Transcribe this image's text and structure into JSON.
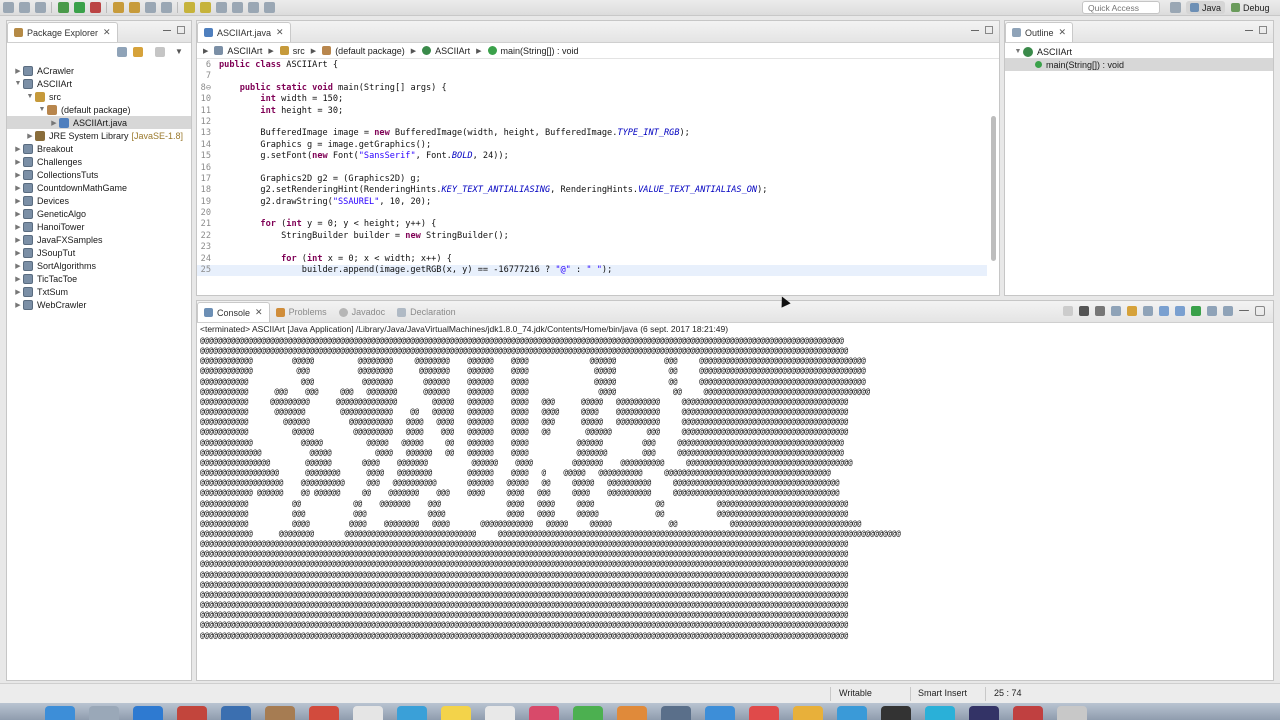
{
  "toolbar": {
    "quick_access_placeholder": "Quick Access",
    "perspectives": [
      "Java",
      "Debug"
    ]
  },
  "package_explorer": {
    "tab_label": "Package Explorer",
    "items": [
      {
        "label": "ACrawler",
        "depth": 0,
        "expanded": false,
        "icon": "project-icon"
      },
      {
        "label": "ASCIIArt",
        "depth": 0,
        "expanded": true,
        "icon": "project-icon"
      },
      {
        "label": "src",
        "depth": 1,
        "expanded": true,
        "icon": "source-folder-icon"
      },
      {
        "label": "(default package)",
        "depth": 2,
        "expanded": true,
        "icon": "package-icon"
      },
      {
        "label": "ASCIIArt.java",
        "depth": 3,
        "expanded": false,
        "icon": "java-file-icon",
        "selected": true
      },
      {
        "label": "JRE System Library",
        "sub": "[JavaSE-1.8]",
        "depth": 1,
        "expanded": false,
        "icon": "library-icon"
      },
      {
        "label": "Breakout",
        "depth": 0,
        "expanded": false,
        "icon": "project-icon"
      },
      {
        "label": "Challenges",
        "depth": 0,
        "expanded": false,
        "icon": "project-icon"
      },
      {
        "label": "CollectionsTuts",
        "depth": 0,
        "expanded": false,
        "icon": "project-icon"
      },
      {
        "label": "CountdownMathGame",
        "depth": 0,
        "expanded": false,
        "icon": "project-icon"
      },
      {
        "label": "Devices",
        "depth": 0,
        "expanded": false,
        "icon": "project-icon"
      },
      {
        "label": "GeneticAlgo",
        "depth": 0,
        "expanded": false,
        "icon": "project-icon"
      },
      {
        "label": "HanoiTower",
        "depth": 0,
        "expanded": false,
        "icon": "project-icon"
      },
      {
        "label": "JavaFXSamples",
        "depth": 0,
        "expanded": false,
        "icon": "project-icon"
      },
      {
        "label": "JSoupTut",
        "depth": 0,
        "expanded": false,
        "icon": "project-icon"
      },
      {
        "label": "SortAlgorithms",
        "depth": 0,
        "expanded": false,
        "icon": "project-icon"
      },
      {
        "label": "TicTacToe",
        "depth": 0,
        "expanded": false,
        "icon": "project-icon"
      },
      {
        "label": "TxtSum",
        "depth": 0,
        "expanded": false,
        "icon": "project-icon"
      },
      {
        "label": "WebCrawler",
        "depth": 0,
        "expanded": false,
        "icon": "project-icon"
      }
    ]
  },
  "editor": {
    "tab_label": "ASCIIArt.java",
    "breadcrumb": [
      "ASCIIArt",
      "src",
      "(default package)",
      "ASCIIArt",
      "main(String[]) : void"
    ],
    "lines": [
      {
        "n": "6",
        "text": "public class ASCIIArt {"
      },
      {
        "n": "7",
        "text": ""
      },
      {
        "n": "8⊖",
        "text": "    public static void main(String[] args) {"
      },
      {
        "n": "10",
        "text": "        int width = 150;"
      },
      {
        "n": "11",
        "text": "        int height = 30;"
      },
      {
        "n": "12",
        "text": ""
      },
      {
        "n": "13",
        "text": "        BufferedImage image = new BufferedImage(width, height, BufferedImage.TYPE_INT_RGB);"
      },
      {
        "n": "14",
        "text": "        Graphics g = image.getGraphics();"
      },
      {
        "n": "15",
        "text": "        g.setFont(new Font(\"SansSerif\", Font.BOLD, 24));"
      },
      {
        "n": "16",
        "text": ""
      },
      {
        "n": "17",
        "text": "        Graphics2D g2 = (Graphics2D) g;"
      },
      {
        "n": "18",
        "text": "        g2.setRenderingHint(RenderingHints.KEY_TEXT_ANTIALIASING, RenderingHints.VALUE_TEXT_ANTIALIAS_ON);"
      },
      {
        "n": "19",
        "text": "        g2.drawString(\"SSAUREL\", 10, 20);"
      },
      {
        "n": "20",
        "text": ""
      },
      {
        "n": "21",
        "text": "        for (int y = 0; y < height; y++) {"
      },
      {
        "n": "22",
        "text": "            StringBuilder builder = new StringBuilder();"
      },
      {
        "n": "23",
        "text": ""
      },
      {
        "n": "24",
        "text": "            for (int x = 0; x < width; x++) {"
      },
      {
        "n": "25",
        "text": "                builder.append(image.getRGB(x, y) == -16777216 ? \"@\" : \" \");",
        "highlight": true
      }
    ]
  },
  "outline": {
    "tab_label": "Outline",
    "items": [
      {
        "label": "ASCIIArt",
        "depth": 0
      },
      {
        "label": "main(String[]) : void",
        "depth": 1,
        "selected": true
      }
    ]
  },
  "console": {
    "tabs": [
      {
        "label": "Console",
        "active": true
      },
      {
        "label": "Problems",
        "active": false
      },
      {
        "label": "Javadoc",
        "active": false
      },
      {
        "label": "Declaration",
        "active": false
      }
    ],
    "info": "<terminated> ASCIIArt [Java Application] /Library/Java/JavaVirtualMachines/jdk1.8.0_74.jdk/Contents/Home/bin/java (6 sept. 2017 18:21:49)",
    "output": "@@@@@@@@@@@@@@@@@@@@@@@@@@@@@@@@@@@@@@@@@@@@@@@@@@@@@@@@@@@@@@@@@@@@@@@@@@@@@@@@@@@@@@@@@@@@@@@@@@@@@@@@@@@@@@@@@@@@@@@@@@@@@@@@@@@@@@@@@@@@@@@@@@@\n@@@@@@@@@@@@@@@@@@@@@@@@@@@@@@@@@@@@@@@@@@@@@@@@@@@@@@@@@@@@@@@@@@@@@@@@@@@@@@@@@@@@@@@@@@@@@@@@@@@@@@@@@@@@@@@@@@@@@@@@@@@@@@@@@@@@@@@@@@@@@@@@@@@@\n@@@@@@@@@@@@         @@@@@          @@@@@@@@     @@@@@@@@    @@@@@@    @@@@              @@@@@@           @@@     @@@@@@@@@@@@@@@@@@@@@@@@@@@@@@@@@@@@@@\n@@@@@@@@@@@@          @@@           @@@@@@@@      @@@@@@@    @@@@@@    @@@@               @@@@@            @@     @@@@@@@@@@@@@@@@@@@@@@@@@@@@@@@@@@@@@@\n@@@@@@@@@@@            @@@           @@@@@@@       @@@@@@    @@@@@@    @@@@               @@@@@            @@     @@@@@@@@@@@@@@@@@@@@@@@@@@@@@@@@@@@@@@\n@@@@@@@@@@@      @@@    @@@     @@@   @@@@@@@      @@@@@@    @@@@@@    @@@@                @@@@             @@     @@@@@@@@@@@@@@@@@@@@@@@@@@@@@@@@@@@@@@\n@@@@@@@@@@@     @@@@@@@@@      @@@@@@@@@@@@@@        @@@@@   @@@@@@    @@@@   @@@      @@@@@   @@@@@@@@@@     @@@@@@@@@@@@@@@@@@@@@@@@@@@@@@@@@@@@@@\n@@@@@@@@@@@      @@@@@@@        @@@@@@@@@@@@    @@   @@@@@   @@@@@@    @@@@   @@@@     @@@@    @@@@@@@@@@     @@@@@@@@@@@@@@@@@@@@@@@@@@@@@@@@@@@@@@\n@@@@@@@@@@@        @@@@@@         @@@@@@@@@@   @@@@   @@@@   @@@@@@    @@@@   @@@      @@@@@   @@@@@@@@@@     @@@@@@@@@@@@@@@@@@@@@@@@@@@@@@@@@@@@@@\n@@@@@@@@@@@          @@@@@         @@@@@@@@@   @@@@    @@@   @@@@@@    @@@@   @@        @@@@@@        @@@     @@@@@@@@@@@@@@@@@@@@@@@@@@@@@@@@@@@@@@\n@@@@@@@@@@@@           @@@@@          @@@@@   @@@@@     @@   @@@@@@    @@@@           @@@@@@         @@@     @@@@@@@@@@@@@@@@@@@@@@@@@@@@@@@@@@@@@@\n@@@@@@@@@@@@@@           @@@@@          @@@@   @@@@@@   @@   @@@@@@    @@@@           @@@@@@@        @@@     @@@@@@@@@@@@@@@@@@@@@@@@@@@@@@@@@@@@@@\n@@@@@@@@@@@@@@@@        @@@@@@       @@@@    @@@@@@@          @@@@@@    @@@@         @@@@@@@    @@@@@@@@@@     @@@@@@@@@@@@@@@@@@@@@@@@@@@@@@@@@@@@@@\n@@@@@@@@@@@@@@@@@@      @@@@@@@@      @@@@   @@@@@@@@        @@@@@@    @@@@   @    @@@@@   @@@@@@@@@@     @@@@@@@@@@@@@@@@@@@@@@@@@@@@@@@@@@@@@@\n@@@@@@@@@@@@@@@@@@@    @@@@@@@@@@     @@@   @@@@@@@@@@       @@@@@@   @@@@@   @@     @@@@@   @@@@@@@@@@     @@@@@@@@@@@@@@@@@@@@@@@@@@@@@@@@@@@@@@\n@@@@@@@@@@@@ @@@@@@    @@ @@@@@@     @@    @@@@@@@    @@@    @@@@     @@@@   @@@     @@@@    @@@@@@@@@@     @@@@@@@@@@@@@@@@@@@@@@@@@@@@@@@@@@@@@@\n@@@@@@@@@@@          @@            @@    @@@@@@@    @@@               @@@@   @@@@     @@@@              @@            @@@@@@@@@@@@@@@@@@@@@@@@@@@@@@\n@@@@@@@@@@@          @@@           @@@              @@@@              @@@@   @@@@     @@@@@             @@            @@@@@@@@@@@@@@@@@@@@@@@@@@@@@@\n@@@@@@@@@@@          @@@@         @@@@    @@@@@@@@   @@@@       @@@@@@@@@@@@   @@@@@     @@@@@             @@            @@@@@@@@@@@@@@@@@@@@@@@@@@@@@@\n@@@@@@@@@@@@      @@@@@@@@       @@@@@@@@@@@@@@@@@@@@@@@@@@@@@@     @@@@@@@@@@@@@@@@@@@@@@@@@@@@@@@@@@@@@@@@@@@@@@@@@@@@@@@@@@@@@@@@@@@@@@@@@@@@@@@@@@@@@@@@@@@@\n@@@@@@@@@@@@@@@@@@@@@@@@@@@@@@@@@@@@@@@@@@@@@@@@@@@@@@@@@@@@@@@@@@@@@@@@@@@@@@@@@@@@@@@@@@@@@@@@@@@@@@@@@@@@@@@@@@@@@@@@@@@@@@@@@@@@@@@@@@@@@@@@@@@@\n@@@@@@@@@@@@@@@@@@@@@@@@@@@@@@@@@@@@@@@@@@@@@@@@@@@@@@@@@@@@@@@@@@@@@@@@@@@@@@@@@@@@@@@@@@@@@@@@@@@@@@@@@@@@@@@@@@@@@@@@@@@@@@@@@@@@@@@@@@@@@@@@@@@@\n@@@@@@@@@@@@@@@@@@@@@@@@@@@@@@@@@@@@@@@@@@@@@@@@@@@@@@@@@@@@@@@@@@@@@@@@@@@@@@@@@@@@@@@@@@@@@@@@@@@@@@@@@@@@@@@@@@@@@@@@@@@@@@@@@@@@@@@@@@@@@@@@@@@@\n@@@@@@@@@@@@@@@@@@@@@@@@@@@@@@@@@@@@@@@@@@@@@@@@@@@@@@@@@@@@@@@@@@@@@@@@@@@@@@@@@@@@@@@@@@@@@@@@@@@@@@@@@@@@@@@@@@@@@@@@@@@@@@@@@@@@@@@@@@@@@@@@@@@@\n@@@@@@@@@@@@@@@@@@@@@@@@@@@@@@@@@@@@@@@@@@@@@@@@@@@@@@@@@@@@@@@@@@@@@@@@@@@@@@@@@@@@@@@@@@@@@@@@@@@@@@@@@@@@@@@@@@@@@@@@@@@@@@@@@@@@@@@@@@@@@@@@@@@@\n@@@@@@@@@@@@@@@@@@@@@@@@@@@@@@@@@@@@@@@@@@@@@@@@@@@@@@@@@@@@@@@@@@@@@@@@@@@@@@@@@@@@@@@@@@@@@@@@@@@@@@@@@@@@@@@@@@@@@@@@@@@@@@@@@@@@@@@@@@@@@@@@@@@@\n@@@@@@@@@@@@@@@@@@@@@@@@@@@@@@@@@@@@@@@@@@@@@@@@@@@@@@@@@@@@@@@@@@@@@@@@@@@@@@@@@@@@@@@@@@@@@@@@@@@@@@@@@@@@@@@@@@@@@@@@@@@@@@@@@@@@@@@@@@@@@@@@@@@@\n@@@@@@@@@@@@@@@@@@@@@@@@@@@@@@@@@@@@@@@@@@@@@@@@@@@@@@@@@@@@@@@@@@@@@@@@@@@@@@@@@@@@@@@@@@@@@@@@@@@@@@@@@@@@@@@@@@@@@@@@@@@@@@@@@@@@@@@@@@@@@@@@@@@@\n@@@@@@@@@@@@@@@@@@@@@@@@@@@@@@@@@@@@@@@@@@@@@@@@@@@@@@@@@@@@@@@@@@@@@@@@@@@@@@@@@@@@@@@@@@@@@@@@@@@@@@@@@@@@@@@@@@@@@@@@@@@@@@@@@@@@@@@@@@@@@@@@@@@@\n@@@@@@@@@@@@@@@@@@@@@@@@@@@@@@@@@@@@@@@@@@@@@@@@@@@@@@@@@@@@@@@@@@@@@@@@@@@@@@@@@@@@@@@@@@@@@@@@@@@@@@@@@@@@@@@@@@@@@@@@@@@@@@@@@@@@@@@@@@@@@@@@@@@@"
  },
  "statusbar": {
    "writable": "Writable",
    "insert_mode": "Smart Insert",
    "position": "25 : 74"
  },
  "colors": {
    "keyword": "#7f0055",
    "string": "#2a00ff",
    "constant": "#0000c0",
    "selection": "#d7d7d7"
  }
}
